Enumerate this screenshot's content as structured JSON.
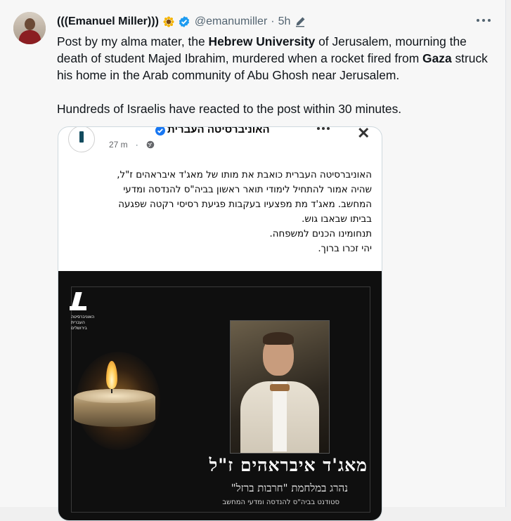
{
  "tweet": {
    "display_name": "(((Emanuel Miller)))",
    "handle": "@emanumiller",
    "separator": "·",
    "time": "5h",
    "text_parts": {
      "p1_a": "Post by my alma mater, the ",
      "p1_b": "Hebrew University",
      "p1_c": " of Jerusalem, mourning the death of student Majed Ibrahim, murdered when a rocket fired from ",
      "p1_d": "Gaza",
      "p1_e": " struck his home in the Arab community of Abu Ghosh near Jerusalem.",
      "p2": "Hundreds of Israelis have reacted to the post within 30 minutes."
    },
    "icons": [
      "avatar",
      "sunflower-emoji",
      "verified-badge-icon",
      "edit-icon",
      "more-icon"
    ],
    "colors": {
      "verified": "#1d9bf0",
      "secondary_text": "#536471"
    }
  },
  "embedded_post": {
    "page_name": "האוניברסיטה העברית",
    "time": "27 m",
    "post_lines": [
      "האוניברסיטה העברית כואבת את מותו של מאג'ד איבראהים ז\"ל,",
      "שהיה אמור להתחיל לימודי תואר ראשון בביה\"ס להנדסה ומדעי",
      "המחשב. מאג'ד מת מפצעיו בעקבות פגיעת רסיסי רקטה שפגעה",
      "בביתו שבאבו גוש.",
      "תנחומינו הכנים למשפחה.",
      "יהי זכרו ברוך."
    ],
    "poster": {
      "logo_text": "האוניברסיטה העברית בירושלים",
      "name": "מאג'ד איבראהים ז\"ל",
      "subtitle": "נהרג במלחמת \"חרבות ברזל\"",
      "subtitle2": "סטודנט בביה\"ס להנדסה ומדעי המחשב"
    }
  }
}
